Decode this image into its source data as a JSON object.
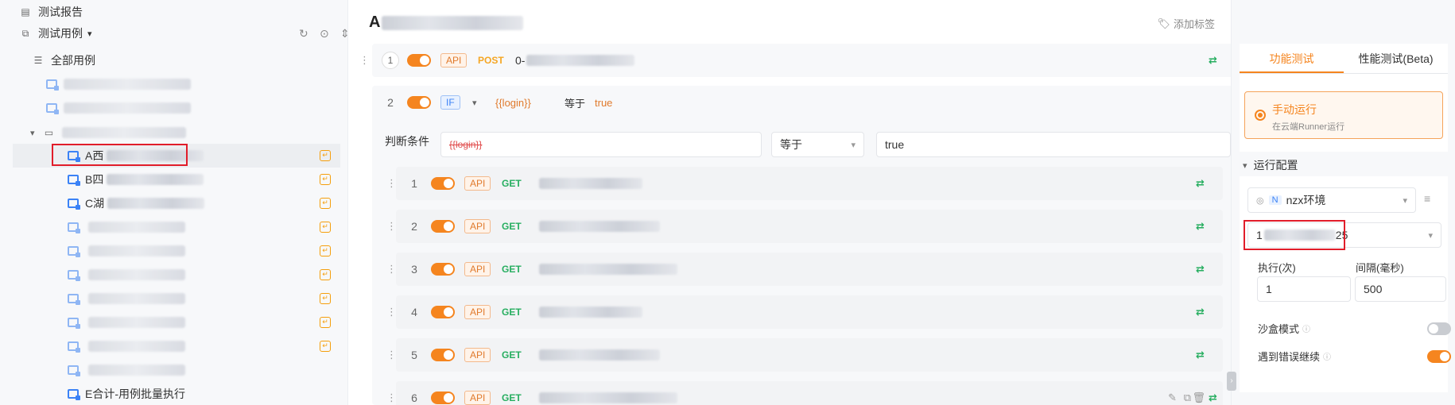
{
  "sidebar": {
    "report_label": "测试报告",
    "cases_label": "测试用例",
    "all_cases_label": "全部用例",
    "items": [
      {
        "label": "A西"
      },
      {
        "label": "B四"
      },
      {
        "label": "C湖"
      }
    ],
    "last_item_label": "E合计-用例批量执行"
  },
  "main": {
    "title_prefix": "A",
    "add_tag_label": "添加标签",
    "step1": {
      "num": "1",
      "tag": "API",
      "method": "POST",
      "url_prefix": "0-"
    },
    "step2": {
      "num": "2",
      "tag": "IF",
      "cond_var": "{{login}}",
      "cond_op": "等于",
      "cond_val": "true"
    },
    "cond_row": {
      "label": "判断条件",
      "var": "{{login}}",
      "op": "等于",
      "val": "true"
    },
    "substeps": [
      {
        "num": "1",
        "tag": "API",
        "method": "GET"
      },
      {
        "num": "2",
        "tag": "API",
        "method": "GET"
      },
      {
        "num": "3",
        "tag": "API",
        "method": "GET"
      },
      {
        "num": "4",
        "tag": "API",
        "method": "GET"
      },
      {
        "num": "5",
        "tag": "API",
        "method": "GET"
      },
      {
        "num": "6",
        "tag": "API",
        "method": "GET"
      }
    ]
  },
  "right": {
    "tab_functional": "功能测试",
    "tab_performance": "性能测试(Beta)",
    "run_mode_title": "手动运行",
    "run_mode_sub": "在云端Runner运行",
    "run_config_label": "运行配置",
    "env_badge": "N",
    "env_name": "nzx环境",
    "dataset_prefix": "1",
    "dataset_suffix": "25",
    "exec_label": "执行(次)",
    "interval_label": "间隔(毫秒)",
    "exec_value": "1",
    "interval_value": "500",
    "sandbox_label": "沙盒模式",
    "continue_on_error_label": "遇到错误继续",
    "sandbox_on": false,
    "continue_on_error_on": true
  },
  "colors": {
    "accent": "#f5851f",
    "api_tag": "#e07a2c",
    "get": "#27ae60",
    "post": "#f5a623",
    "highlight_box": "#e11d2a"
  }
}
